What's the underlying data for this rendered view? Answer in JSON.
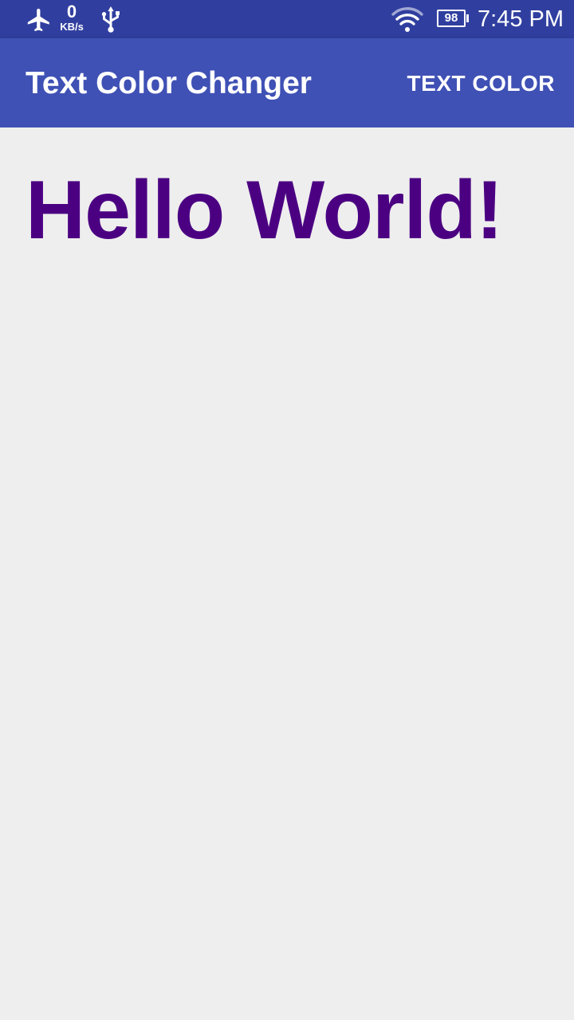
{
  "status_bar": {
    "net_speed_value": "0",
    "net_speed_unit": "KB/s",
    "battery_level": "98",
    "time": "7:45 PM",
    "background_color": "#303f9f",
    "icons": [
      "airplane-mode-icon",
      "usb-icon",
      "wifi-icon",
      "battery-icon"
    ]
  },
  "app_bar": {
    "title": "Text Color Changer",
    "action_label": "TEXT COLOR",
    "background_color": "#3f51b5"
  },
  "content": {
    "message": "Hello World!",
    "message_color": "#4b0082",
    "background_color": "#eeeeee"
  }
}
